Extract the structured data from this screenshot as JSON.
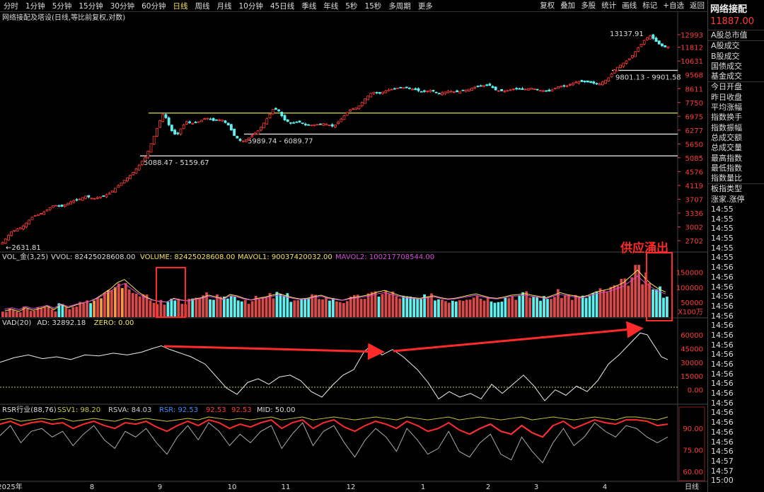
{
  "toolbar": {
    "tabs": [
      "分时",
      "1分钟",
      "5分钟",
      "15分钟",
      "30分钟",
      "60分钟",
      "日线",
      "周线",
      "月线",
      "10分钟",
      "45日线",
      "季线",
      "年线",
      "5秒",
      "15秒",
      "多周期",
      "更多"
    ],
    "active_tab": "日线",
    "tools": [
      "复权",
      "叠加",
      "多股",
      "统计",
      "画线",
      "标记",
      "+自选",
      "返回"
    ]
  },
  "sidebar": {
    "index_name": "网络接配",
    "price": "11887.00",
    "fields": [
      "A股总市值",
      "A股成交",
      "B股成交",
      "国债成交",
      "基金成交",
      "今日开盘",
      "昨日收盘",
      "平均涨幅",
      "指数换手",
      "指数振幅",
      "总成交额",
      "总成交量",
      "最高指数",
      "最低指数",
      "指数量比",
      "板指类型",
      "涨家.涨停"
    ],
    "times": [
      "14:55",
      "14:55",
      "14:55",
      "14:55",
      "14:55",
      "14:55",
      "14:56",
      "14:56",
      "14:56",
      "14:56",
      "14:56",
      "14:56",
      "14:56",
      "14:56",
      "14:56",
      "14:56",
      "14:56",
      "14:56",
      "14:56",
      "14:56",
      "14:56",
      "14:56",
      "14:56",
      "14:56",
      "14:56",
      "14:56",
      "14:57",
      "14:57",
      "15:00"
    ]
  },
  "annotations": {
    "callout": "供应涌出",
    "colors": {
      "up": "#ff3c3c",
      "down": "#5ff0f0",
      "highlight": "#ff2a2a",
      "ma5": "#f5e35a",
      "ma10": "#ff9a2e",
      "ma20": "#d84cd8"
    }
  },
  "chart_data": [
    {
      "type": "candlestick",
      "title": "网络接配及塔设(日线,等比前复权,对数)",
      "y_ticks": [
        12993,
        11812,
        10631,
        9568,
        8611,
        7750,
        6975,
        6277,
        5650,
        5085,
        4576,
        4119,
        3707,
        3336,
        3002,
        2702
      ],
      "ylim": [
        2560,
        14400
      ],
      "log_scale": true,
      "series": [
        {
          "name": "close",
          "points": [
            [
              0,
              2632
            ],
            [
              15,
              2900
            ],
            [
              30,
              3000
            ],
            [
              45,
              3250
            ],
            [
              60,
              3350
            ],
            [
              75,
              3550
            ],
            [
              85,
              3500
            ],
            [
              100,
              3650
            ],
            [
              110,
              3700
            ],
            [
              120,
              3800
            ],
            [
              130,
              3720
            ],
            [
              145,
              3800
            ],
            [
              155,
              3900
            ],
            [
              165,
              4100
            ],
            [
              175,
              4300
            ],
            [
              185,
              4500
            ],
            [
              195,
              4800
            ],
            [
              205,
              5150
            ],
            [
              215,
              5900
            ],
            [
              222,
              6500
            ],
            [
              228,
              7100
            ],
            [
              233,
              6900
            ],
            [
              240,
              6300
            ],
            [
              248,
              6000
            ],
            [
              255,
              6400
            ],
            [
              262,
              6700
            ],
            [
              270,
              6600
            ],
            [
              280,
              6700
            ],
            [
              290,
              6900
            ],
            [
              300,
              6750
            ],
            [
              312,
              6800
            ],
            [
              322,
              6500
            ],
            [
              330,
              6000
            ],
            [
              340,
              5750
            ],
            [
              348,
              5850
            ],
            [
              356,
              6050
            ],
            [
              365,
              6300
            ],
            [
              375,
              6800
            ],
            [
              385,
              7400
            ],
            [
              392,
              7300
            ],
            [
              400,
              6800
            ],
            [
              410,
              6600
            ],
            [
              420,
              6700
            ],
            [
              432,
              6500
            ],
            [
              445,
              6550
            ],
            [
              458,
              6600
            ],
            [
              470,
              6450
            ],
            [
              480,
              6800
            ],
            [
              492,
              7300
            ],
            [
              505,
              7500
            ],
            [
              515,
              8000
            ],
            [
              525,
              8400
            ],
            [
              535,
              8300
            ],
            [
              545,
              8500
            ],
            [
              555,
              8600
            ],
            [
              565,
              8700
            ],
            [
              575,
              8650
            ],
            [
              585,
              8550
            ],
            [
              595,
              8400
            ],
            [
              608,
              8500
            ],
            [
              620,
              8300
            ],
            [
              632,
              8450
            ],
            [
              645,
              8400
            ],
            [
              660,
              8550
            ],
            [
              675,
              8800
            ],
            [
              690,
              8850
            ],
            [
              700,
              8500
            ],
            [
              712,
              8450
            ],
            [
              725,
              8600
            ],
            [
              738,
              8550
            ],
            [
              750,
              8650
            ],
            [
              762,
              8500
            ],
            [
              775,
              8450
            ],
            [
              788,
              8750
            ],
            [
              800,
              8800
            ],
            [
              815,
              9100
            ],
            [
              830,
              9050
            ],
            [
              845,
              8900
            ],
            [
              858,
              9300
            ],
            [
              868,
              10000
            ],
            [
              878,
              10400
            ],
            [
              890,
              10900
            ],
            [
              900,
              11700
            ],
            [
              910,
              12500
            ],
            [
              918,
              12900
            ],
            [
              925,
              12400
            ],
            [
              932,
              12000
            ],
            [
              940,
              11800
            ],
            [
              944,
              11887
            ]
          ]
        }
      ],
      "high_label": "13137.91",
      "low_label": "2631.81",
      "horizontal_levels": [
        {
          "value": 7150,
          "label": ""
        },
        {
          "value": 6089.77,
          "label": "5989.74 - 6089.77"
        },
        {
          "value": 5159.67,
          "label": "5088.47 - 5159.67"
        },
        {
          "value": 9901.58,
          "label": "9801.13 - 9901.58"
        }
      ]
    },
    {
      "type": "bar",
      "title": "VOL_金(3,25)",
      "legend": [
        "VVOL: 82425028608.00",
        "VOLUME: 82425028608.00",
        "MAVOL1: 90037420032.00",
        "MAVOL2: 100217708544.00"
      ],
      "y_ticks": [
        "150000",
        "100000",
        "50000"
      ],
      "unit": "X100万",
      "ylim": [
        0,
        180000
      ],
      "values_sample": [
        20000,
        25000,
        18000,
        30000,
        22000,
        28000,
        35000,
        24000,
        40000,
        30000,
        38000,
        45000,
        50000,
        60000,
        75000,
        90000,
        110000,
        120000,
        100000,
        80000,
        65000,
        55000,
        50000,
        48000,
        60000,
        55000,
        52000,
        58000,
        62000,
        70000,
        65000,
        58000,
        72000,
        68000,
        60000,
        55000,
        60000,
        64000,
        70000,
        75000,
        68000,
        62000,
        58000,
        60000,
        66000,
        70000,
        62000,
        58000,
        54000,
        60000,
        64000,
        68000,
        72000,
        80000,
        85000,
        78000,
        70000,
        65000,
        62000,
        60000,
        64000,
        68000,
        62000,
        58000,
        60000,
        65000,
        70000,
        74000,
        68000,
        62000,
        60000,
        64000,
        70000,
        72000,
        75000,
        70000,
        66000,
        62000,
        70000,
        78000,
        72000,
        68000,
        64000,
        70000,
        80000,
        85000,
        90000,
        100000,
        110000,
        130000,
        150000,
        125000,
        105000,
        90000,
        80000
      ]
    },
    {
      "type": "line",
      "title": "VAD(20)",
      "legend": [
        "AD: 32892.18",
        "ZERO: 0.00"
      ],
      "y_ticks": [
        "60000",
        "45000",
        "30000",
        "15000",
        "0.00"
      ],
      "ylim": [
        -15000,
        70000
      ],
      "points": [
        [
          0,
          30000
        ],
        [
          20,
          35000
        ],
        [
          40,
          38000
        ],
        [
          60,
          34000
        ],
        [
          80,
          36000
        ],
        [
          100,
          33000
        ],
        [
          120,
          38000
        ],
        [
          140,
          37000
        ],
        [
          160,
          40000
        ],
        [
          180,
          38000
        ],
        [
          200,
          41000
        ],
        [
          215,
          45000
        ],
        [
          228,
          48000
        ],
        [
          240,
          44000
        ],
        [
          255,
          40000
        ],
        [
          270,
          36000
        ],
        [
          290,
          28000
        ],
        [
          305,
          15000
        ],
        [
          320,
          2000
        ],
        [
          335,
          -5000
        ],
        [
          350,
          8000
        ],
        [
          365,
          12000
        ],
        [
          380,
          6000
        ],
        [
          395,
          14000
        ],
        [
          410,
          16000
        ],
        [
          425,
          10000
        ],
        [
          440,
          -2000
        ],
        [
          455,
          -8000
        ],
        [
          470,
          5000
        ],
        [
          485,
          16000
        ],
        [
          500,
          22000
        ],
        [
          515,
          42000
        ],
        [
          525,
          48000
        ],
        [
          540,
          38000
        ],
        [
          555,
          44000
        ],
        [
          570,
          36000
        ],
        [
          590,
          22000
        ],
        [
          605,
          8000
        ],
        [
          620,
          -10000
        ],
        [
          635,
          -2000
        ],
        [
          650,
          -8000
        ],
        [
          665,
          -4000
        ],
        [
          680,
          -10000
        ],
        [
          695,
          6000
        ],
        [
          710,
          -4000
        ],
        [
          725,
          6000
        ],
        [
          740,
          16000
        ],
        [
          755,
          4000
        ],
        [
          770,
          -12000
        ],
        [
          785,
          0
        ],
        [
          800,
          -6000
        ],
        [
          815,
          4000
        ],
        [
          830,
          -2000
        ],
        [
          845,
          10000
        ],
        [
          860,
          28000
        ],
        [
          875,
          38000
        ],
        [
          890,
          50000
        ],
        [
          905,
          62000
        ],
        [
          915,
          60000
        ],
        [
          925,
          48000
        ],
        [
          935,
          36000
        ],
        [
          944,
          32892
        ]
      ]
    },
    {
      "type": "line",
      "title": "RSR行业(88,76)",
      "legend": [
        "SSV1: 98.20",
        "RSVA: 84.03",
        "RSR: 92.53",
        "92.53",
        "92.53",
        "MID: 50.00"
      ],
      "y_ticks": [
        "90.00",
        "75.00",
        "60.00"
      ],
      "ylim": [
        55,
        100
      ],
      "series": [
        {
          "name": "SSV1",
          "values": [
            96,
            97,
            95,
            96,
            97,
            96,
            97,
            95,
            96,
            97,
            96,
            95,
            97,
            96,
            97,
            96,
            95,
            96,
            97,
            96,
            98,
            97,
            96,
            97,
            96,
            97,
            98,
            96,
            97,
            98,
            96,
            97,
            98,
            97,
            96,
            97,
            98,
            97,
            96,
            98,
            97,
            96,
            97,
            98,
            96,
            97,
            98,
            97,
            96,
            97,
            98,
            96,
            97,
            98,
            97,
            96,
            97,
            98,
            97,
            96,
            98,
            98,
            97,
            96,
            98
          ]
        },
        {
          "name": "RSR",
          "values": [
            93,
            95,
            92,
            94,
            95,
            93,
            94,
            90,
            93,
            95,
            92,
            90,
            94,
            93,
            95,
            91,
            88,
            92,
            95,
            92,
            96,
            94,
            90,
            93,
            91,
            94,
            96,
            90,
            94,
            96,
            90,
            94,
            96,
            91,
            88,
            92,
            95,
            93,
            90,
            95,
            92,
            88,
            90,
            94,
            89,
            86,
            90,
            93,
            88,
            86,
            92,
            87,
            84,
            92,
            95,
            90,
            93,
            96,
            94,
            93,
            96,
            96,
            95,
            92,
            93
          ]
        },
        {
          "name": "RSVA",
          "values": [
            85,
            92,
            80,
            88,
            90,
            84,
            88,
            78,
            86,
            92,
            82,
            76,
            88,
            84,
            90,
            80,
            72,
            84,
            92,
            82,
            94,
            88,
            78,
            86,
            80,
            88,
            92,
            76,
            86,
            94,
            78,
            88,
            92,
            80,
            70,
            82,
            90,
            84,
            74,
            90,
            82,
            72,
            76,
            88,
            74,
            70,
            80,
            86,
            72,
            68,
            84,
            74,
            66,
            80,
            90,
            78,
            84,
            94,
            88,
            84,
            92,
            90,
            84,
            80,
            84
          ]
        }
      ]
    }
  ],
  "xaxis": {
    "labels": [
      "2025年",
      "8",
      "9",
      "10",
      "11",
      "12",
      "1",
      "2",
      "3",
      "4"
    ],
    "positions": [
      14,
      130,
      226,
      328,
      404,
      496,
      598,
      690,
      758,
      855
    ],
    "tail_label": "日线"
  }
}
